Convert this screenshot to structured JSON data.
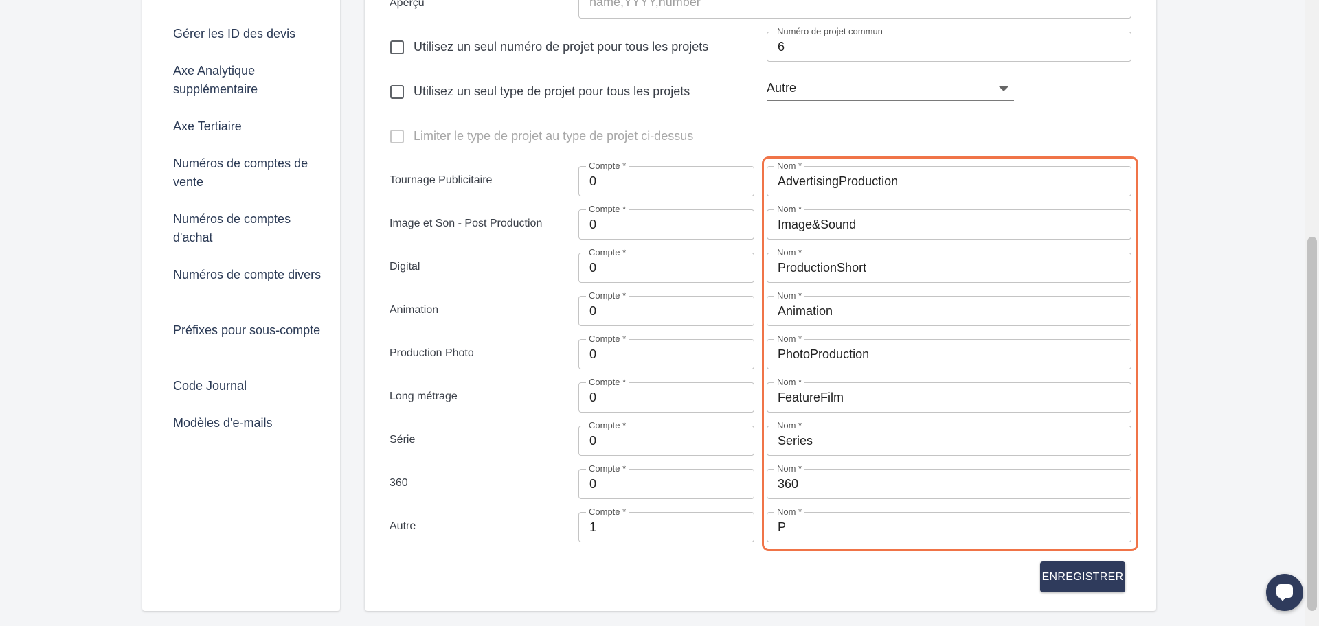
{
  "sidebar": {
    "items": [
      {
        "label": "Gérer les ID des devis"
      },
      {
        "label": "Axe Analytique supplémentaire"
      },
      {
        "label": "Axe Tertiaire"
      },
      {
        "label": "Numéros de comptes de vente"
      },
      {
        "label": "Numéros de comptes d'achat"
      },
      {
        "label": "Numéros de compte divers"
      },
      {
        "label": "Préfixes pour sous-compte"
      },
      {
        "label": "Code Journal"
      },
      {
        "label": "Modèles d'e-mails"
      }
    ]
  },
  "form": {
    "preview": {
      "label": "Aperçu",
      "placeholder": "name,YYYY,number"
    },
    "single_number": {
      "label": "Utilisez un seul numéro de projet pour tous les projets",
      "field_label": "Numéro de projet commun",
      "value": "6"
    },
    "single_type": {
      "label": "Utilisez un seul type de projet pour tous les projets",
      "selected": "Autre"
    },
    "limit_type": {
      "label": "Limiter le type de projet au type de projet ci-dessus"
    },
    "compte_label": "Compte *",
    "nom_label": "Nom *",
    "rows": [
      {
        "label": "Tournage Publicitaire",
        "compte": "0",
        "nom": "AdvertisingProduction"
      },
      {
        "label": "Image et Son - Post Production",
        "compte": "0",
        "nom": "Image&Sound"
      },
      {
        "label": "Digital",
        "compte": "0",
        "nom": "ProductionShort"
      },
      {
        "label": "Animation",
        "compte": "0",
        "nom": "Animation"
      },
      {
        "label": "Production Photo",
        "compte": "0",
        "nom": "PhotoProduction"
      },
      {
        "label": "Long métrage",
        "compte": "0",
        "nom": "FeatureFilm"
      },
      {
        "label": "Série",
        "compte": "0",
        "nom": "Series"
      },
      {
        "label": "360",
        "compte": "0",
        "nom": "360"
      },
      {
        "label": "Autre",
        "compte": "1",
        "nom": "P"
      }
    ],
    "save_label": "ENREGISTRER"
  },
  "colors": {
    "accent": "#2f3b5c",
    "highlight": "#f07448"
  },
  "icons": {
    "chat": "chat-bubble-icon",
    "dropdown": "chevron-down-icon"
  }
}
